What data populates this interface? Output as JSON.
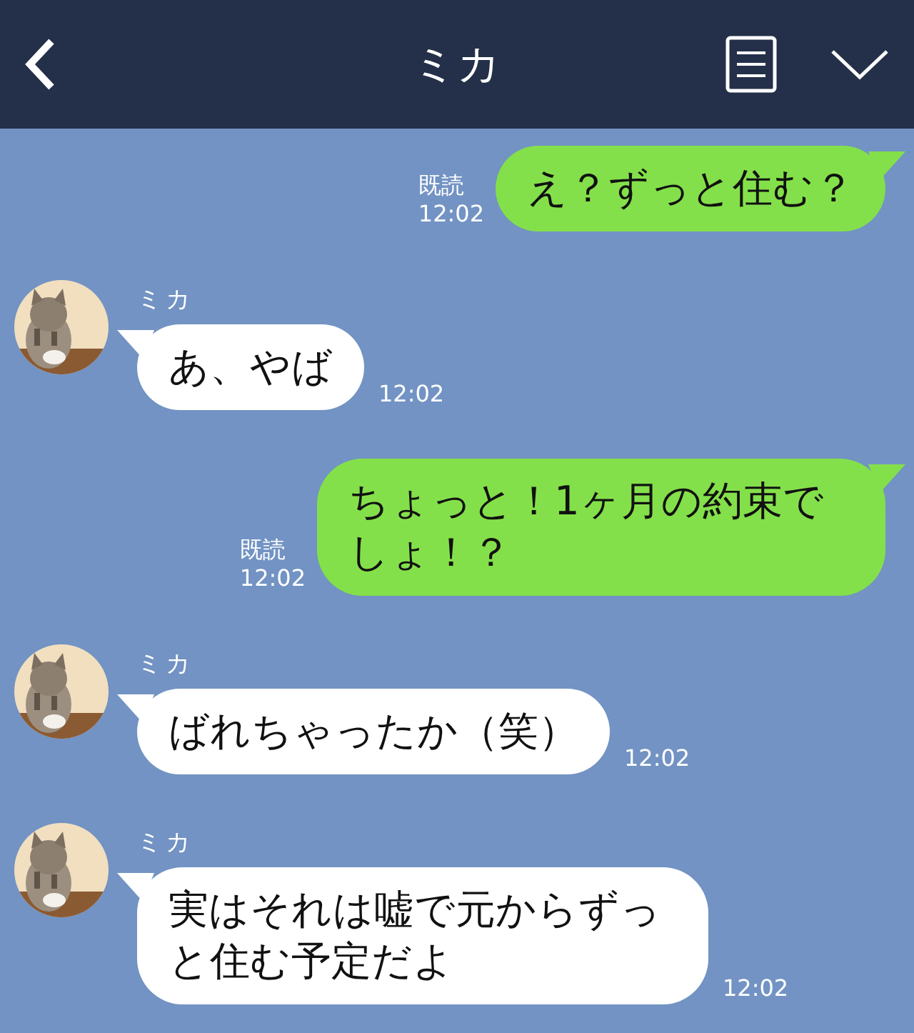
{
  "header": {
    "title": "ミカ"
  },
  "messages": [
    {
      "kind": "sent",
      "text": "え？ずっと住む？",
      "read": "既読",
      "time": "12:02"
    },
    {
      "kind": "received",
      "name": "ミカ",
      "text": "あ、やば",
      "time": "12:02"
    },
    {
      "kind": "sent",
      "text": "ちょっと！1ヶ月の約束でしょ！？",
      "read": "既読",
      "time": "12:02"
    },
    {
      "kind": "received",
      "name": "ミカ",
      "text": "ばれちゃったか（笑）",
      "time": "12:02"
    },
    {
      "kind": "received",
      "name": "ミカ",
      "text": "実はそれは嘘で元からずっと住む予定だよ",
      "time": "12:02"
    }
  ]
}
